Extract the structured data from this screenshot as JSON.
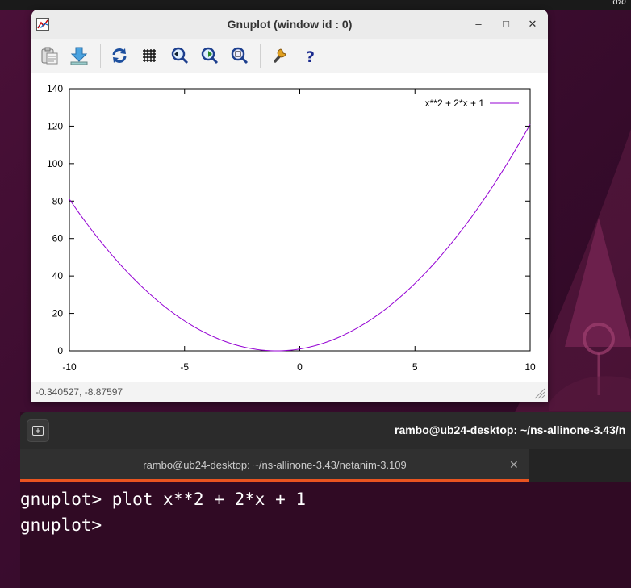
{
  "desktop": {
    "topbar_text": "ሰነዐ"
  },
  "gnuplot_window": {
    "title": "Gnuplot (window id : 0)",
    "app_icon": "gnuplot-app-icon",
    "window_controls": [
      {
        "name": "minimize-icon",
        "glyph": "–"
      },
      {
        "name": "maximize-icon",
        "glyph": "□"
      },
      {
        "name": "close-icon",
        "glyph": "✕"
      }
    ],
    "toolbar_icons": [
      "copy-to-clipboard-icon",
      "export-icon",
      "replot-icon",
      "grid-icon",
      "zoom-previous-icon",
      "zoom-next-icon",
      "autoscale-icon",
      "settings-wrench-icon",
      "help-icon"
    ],
    "status_coords": "-0.340527, -8.87597"
  },
  "chart_data": {
    "type": "line",
    "function": "x**2 + 2*x + 1",
    "series": [
      {
        "name": "x**2 + 2*x + 1",
        "color": "#9400d3",
        "x": [
          -10,
          -9,
          -8,
          -7,
          -6,
          -5,
          -4,
          -3,
          -2,
          -1,
          0,
          1,
          2,
          3,
          4,
          5,
          6,
          7,
          8,
          9,
          10
        ],
        "y": [
          81,
          64,
          49,
          36,
          25,
          16,
          9,
          4,
          1,
          0,
          1,
          4,
          9,
          16,
          25,
          36,
          49,
          64,
          81,
          100,
          121
        ]
      }
    ],
    "xlim": [
      -10,
      10
    ],
    "ylim": [
      0,
      140
    ],
    "xticks": [
      -10,
      -5,
      0,
      5,
      10
    ],
    "yticks": [
      0,
      20,
      40,
      60,
      80,
      100,
      120,
      140
    ],
    "grid": false,
    "legend_position": "top-right",
    "title": "",
    "xlabel": "",
    "ylabel": ""
  },
  "terminal": {
    "window_title": "rambo@ub24-desktop: ~/ns-allinone-3.43/n",
    "tab_label": "rambo@ub24-desktop: ~/ns-allinone-3.43/netanim-3.109",
    "tab_close": "✕",
    "lines": [
      "gnuplot> plot x**2 + 2*x + 1",
      "gnuplot> "
    ]
  },
  "colors": {
    "accent": "#e95420",
    "terminal_bg": "#300a24",
    "plot_line": "#9400d3"
  }
}
